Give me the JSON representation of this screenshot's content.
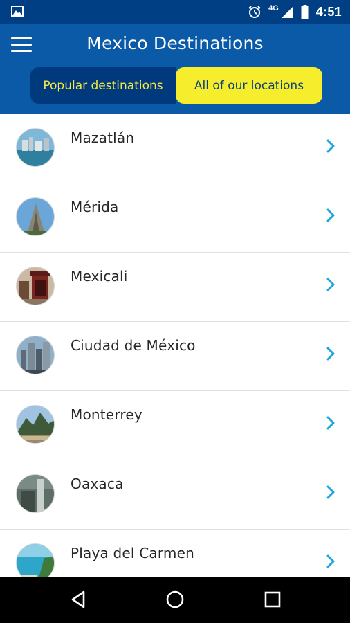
{
  "status_bar": {
    "time": "4:51",
    "network": "4G",
    "icons": [
      "image-icon",
      "alarm-icon",
      "network-icon",
      "signal-icon",
      "battery-icon"
    ]
  },
  "header": {
    "title": "Mexico Destinations",
    "menu_icon": "menu-icon"
  },
  "tabs": [
    {
      "label": "Popular destinations",
      "selected": false
    },
    {
      "label": "All of our locations",
      "selected": true
    }
  ],
  "destinations": [
    {
      "name": "Mazatlán"
    },
    {
      "name": "Mérida"
    },
    {
      "name": "Mexicali"
    },
    {
      "name": "Ciudad de México"
    },
    {
      "name": "Monterrey"
    },
    {
      "name": "Oaxaca"
    },
    {
      "name": "Playa del Carmen"
    }
  ],
  "navigation": {
    "icons": [
      "back-icon",
      "home-icon",
      "recents-icon"
    ]
  },
  "colors": {
    "status_bar": "#003f84",
    "app_bar": "#0a5aa8",
    "tab_inactive_bg": "#003a7c",
    "tab_inactive_text": "#f2e84a",
    "tab_active_bg": "#f6ee2c",
    "tab_active_text": "#0d3f7a",
    "chevron": "#1aa7e0"
  }
}
